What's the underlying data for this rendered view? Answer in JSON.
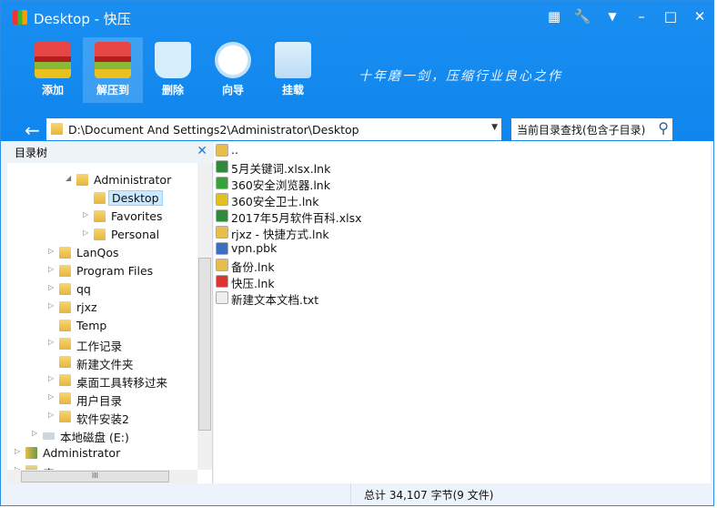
{
  "window": {
    "title": "Desktop - 快压",
    "controls": [
      "grid-icon",
      "wrench-icon",
      "menu-down-icon",
      "minimize-icon",
      "maximize-icon",
      "close-icon"
    ]
  },
  "toolbar": [
    {
      "label": "添加",
      "icon": "add-archive-icon"
    },
    {
      "label": "解压到",
      "icon": "extract-icon"
    },
    {
      "label": "删除",
      "icon": "recycle-bin-icon"
    },
    {
      "label": "向导",
      "icon": "compass-icon"
    },
    {
      "label": "挂载",
      "icon": "drive-icon"
    }
  ],
  "slogan": "十年磨一剑，压缩行业良心之作",
  "address": {
    "path": "D:\\Document And Settings2\\Administrator\\Desktop"
  },
  "search": {
    "placeholder": "当前目录查找(包含子目录)"
  },
  "tree": {
    "header": "目录树",
    "items": [
      {
        "label": "Administrator",
        "level": 3,
        "expanded": true
      },
      {
        "label": "Desktop",
        "level": 4,
        "selected": true
      },
      {
        "label": "Favorites",
        "level": 4,
        "expandable": true
      },
      {
        "label": "Personal",
        "level": 4,
        "expandable": true
      },
      {
        "label": "LanQos",
        "level": 2,
        "expandable": true
      },
      {
        "label": "Program Files",
        "level": 2,
        "expandable": true
      },
      {
        "label": "qq",
        "level": 2,
        "expandable": true
      },
      {
        "label": "rjxz",
        "level": 2,
        "expandable": true
      },
      {
        "label": "Temp",
        "level": 2
      },
      {
        "label": "工作记录",
        "level": 2,
        "expandable": true
      },
      {
        "label": "新建文件夹",
        "level": 2
      },
      {
        "label": "桌面工具转移过来",
        "level": 2,
        "expandable": true
      },
      {
        "label": "用户目录",
        "level": 2,
        "expandable": true
      },
      {
        "label": "软件安装2",
        "level": 2,
        "expandable": true
      },
      {
        "label": "本地磁盘 (E:)",
        "level": 1,
        "expandable": true,
        "icon": "drive"
      },
      {
        "label": "Administrator",
        "level": 0,
        "expandable": true,
        "icon": "user"
      },
      {
        "label": "库",
        "level": 0,
        "expandable": true,
        "icon": "library"
      }
    ]
  },
  "files": [
    {
      "name": "..",
      "color": "#e9bd4a"
    },
    {
      "name": "5月关键词.xlsx.lnk",
      "color": "#2f8a3c"
    },
    {
      "name": "360安全浏览器.lnk",
      "color": "#36a33a"
    },
    {
      "name": "360安全卫士.lnk",
      "color": "#e1c21b"
    },
    {
      "name": "2017年5月软件百科.xlsx",
      "color": "#2f8a3c"
    },
    {
      "name": "rjxz - 快捷方式.lnk",
      "color": "#e9bd4a"
    },
    {
      "name": "vpn.pbk",
      "color": "#3a6fc4"
    },
    {
      "name": "备份.lnk",
      "color": "#e9bd4a"
    },
    {
      "name": "快压.lnk",
      "color": "#d33"
    },
    {
      "name": "新建文本文档.txt",
      "color": "#eeeeee"
    }
  ],
  "status": "总计  34,107 字节(9 文件)"
}
